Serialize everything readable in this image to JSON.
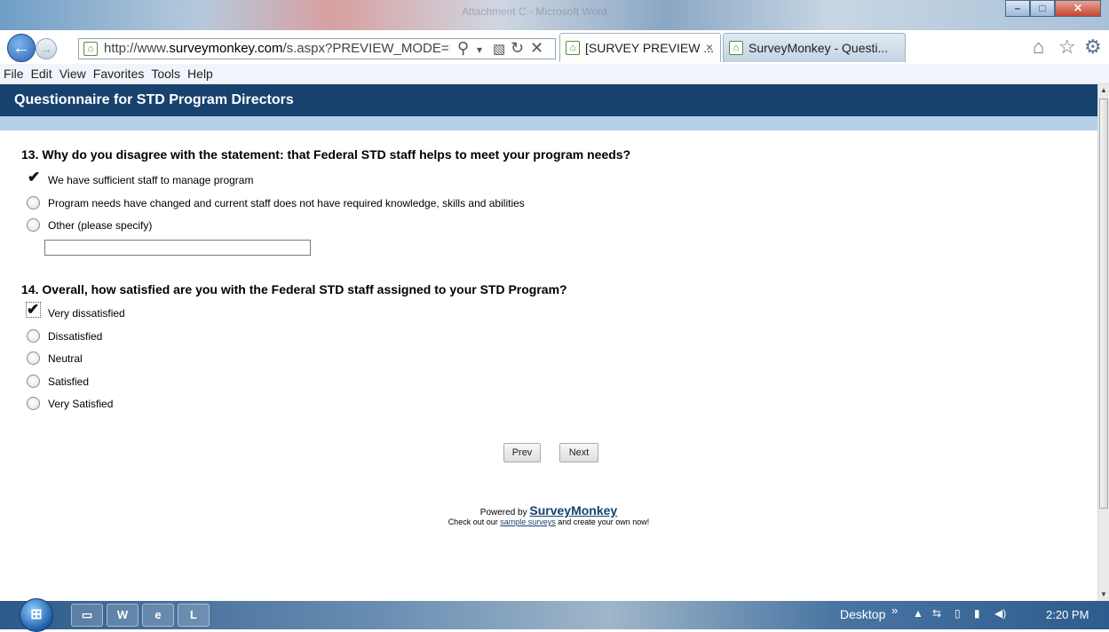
{
  "browser": {
    "url_prefix": "http://www.",
    "url_domain": "surveymonkey.com",
    "url_rest": "/s.aspx?PREVIEW_MODE=DO_NO",
    "tabs": [
      {
        "label": "[SURVEY PREVIEW ...",
        "close": "×"
      },
      {
        "label": "SurveyMonkey - Questi..."
      }
    ],
    "window_title_hint": "Attachment C - Microsoft Word"
  },
  "menu": {
    "items": [
      "File",
      "Edit",
      "View",
      "Favorites",
      "Tools",
      "Help"
    ]
  },
  "survey": {
    "title": "Questionnaire for STD Program Directors",
    "q13": {
      "text": "13. Why do you disagree with the statement: that Federal STD staff helps to meet your program needs?",
      "options": [
        {
          "label": "We have sufficient staff to manage program",
          "selected": true
        },
        {
          "label": "Program needs have changed and current staff does not have required knowledge, skills and abilities",
          "selected": false
        },
        {
          "label": "Other (please specify)",
          "selected": false
        }
      ],
      "other_value": ""
    },
    "q14": {
      "text": "14. Overall, how satisfied are you with the Federal STD staff assigned to your STD Program?",
      "options": [
        {
          "label": "Very dissatisfied",
          "selected": true
        },
        {
          "label": "Dissatisfied",
          "selected": false
        },
        {
          "label": "Neutral",
          "selected": false
        },
        {
          "label": "Satisfied",
          "selected": false
        },
        {
          "label": "Very Satisfied",
          "selected": false
        }
      ]
    },
    "buttons": {
      "prev": "Prev",
      "next": "Next"
    },
    "footer": {
      "powered_by": "Powered by ",
      "brand": "SurveyMonkey",
      "checkout_prefix": "Check out our ",
      "checkout_link": "sample surveys",
      "checkout_suffix": " and create your own now!"
    }
  },
  "taskbar": {
    "desktop": "Desktop",
    "time": "2:20 PM",
    "apps": [
      "folder-icon",
      "word-icon",
      "ie-icon",
      "app-icon"
    ]
  },
  "colors": {
    "header_bg": "#17426e",
    "header_band": "#b5cfe9",
    "accent": "#17426e"
  }
}
